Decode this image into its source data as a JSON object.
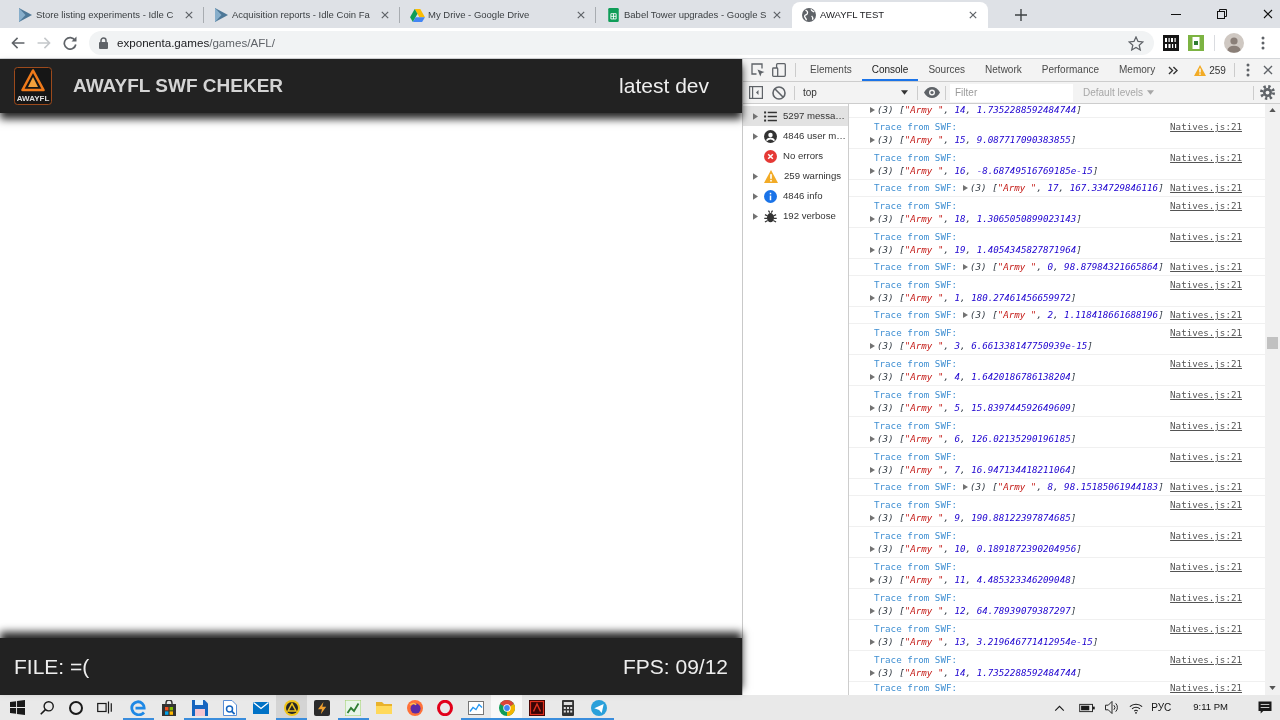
{
  "browser": {
    "tabs": [
      {
        "title": "Store listing experiments - Idle C",
        "selected": false
      },
      {
        "title": "Acquisition reports - Idle Coin Fa",
        "selected": false
      },
      {
        "title": "My Drive - Google Drive",
        "selected": false
      },
      {
        "title": "Babel Tower upgrades - Google S",
        "selected": false
      },
      {
        "title": "AWAYFL TEST",
        "selected": true
      }
    ],
    "navigation": {
      "back_disabled": false,
      "forward_disabled": true
    },
    "address": {
      "host": "exponenta.games",
      "path": "/games/AFL/"
    }
  },
  "page": {
    "logo_text": "AWAYFL",
    "title": "AWAYFL SWF CHEKER",
    "build": "latest dev",
    "file_status": "FILE: =(",
    "fps": "FPS: 09/12"
  },
  "devtools": {
    "tabs": [
      {
        "label": "Elements",
        "selected": false
      },
      {
        "label": "Console",
        "selected": true
      },
      {
        "label": "Sources",
        "selected": false
      },
      {
        "label": "Network",
        "selected": false
      },
      {
        "label": "Performance",
        "selected": false
      },
      {
        "label": "Memory",
        "selected": false
      }
    ],
    "warning_count": "259",
    "console_toolbar": {
      "context": "top",
      "filter": {
        "placeholder": "Filter"
      },
      "levels": {
        "label": "Default levels",
        "disabled": true
      }
    },
    "sidebar": [
      {
        "label": "5297 messa…",
        "selected": true,
        "expandable": true
      },
      {
        "label": "4846 user m…",
        "selected": false,
        "expandable": true
      },
      {
        "label": "No errors",
        "selected": false,
        "expandable": false
      },
      {
        "label": "259 warnings",
        "selected": false,
        "expandable": true
      },
      {
        "label": "4846 info",
        "selected": false,
        "expandable": true
      },
      {
        "label": "192 verbose",
        "selected": false,
        "expandable": true
      }
    ],
    "messages": [
      {
        "kind": "tail",
        "preview": "(3) [\"Army \", 14, 1.7352288592484744]",
        "expanded": false
      },
      {
        "kind": "wrapped",
        "label": "Trace from SWF:",
        "preview": "(3) [\"Army \", 15, 9.087717090383855]",
        "expanded": false,
        "source": "Natives.js:21"
      },
      {
        "kind": "wrapped",
        "label": "Trace from SWF:",
        "preview": "(3) [\"Army \", 16, -8.68749516769185e-15]",
        "expanded": false,
        "source": "Natives.js:21"
      },
      {
        "kind": "inline",
        "label": "Trace from SWF:",
        "preview": "(3) [\"Army \", 17, 167.334729846116]",
        "expanded": false,
        "source": "Natives.js:21"
      },
      {
        "kind": "wrapped",
        "label": "Trace from SWF:",
        "preview": "(3) [\"Army \", 18, 1.3065050899023143]",
        "expanded": false,
        "source": "Natives.js:21"
      },
      {
        "kind": "wrapped",
        "label": "Trace from SWF:",
        "preview": "(3) [\"Army \", 19, 1.4054345827871964]",
        "expanded": false,
        "source": "Natives.js:21"
      },
      {
        "kind": "inline",
        "label": "Trace from SWF:",
        "preview": "(3) [\"Army \", 0, 98.87984321665864]",
        "expanded": false,
        "source": "Natives.js:21"
      },
      {
        "kind": "wrapped",
        "label": "Trace from SWF:",
        "preview": "(3) [\"Army \", 1, 180.27461456659972]",
        "expanded": false,
        "source": "Natives.js:21"
      },
      {
        "kind": "inline",
        "label": "Trace from SWF:",
        "preview": "(3) [\"Army \", 2, 1.118418661688196]",
        "expanded": false,
        "source": "Natives.js:21"
      },
      {
        "kind": "wrapped",
        "label": "Trace from SWF:",
        "preview": "(3) [\"Army \", 3, 6.661338147750939e-15]",
        "expanded": false,
        "source": "Natives.js:21"
      },
      {
        "kind": "wrapped",
        "label": "Trace from SWF:",
        "preview": "(3) [\"Army \", 4, 1.6420186786138204]",
        "expanded": false,
        "source": "Natives.js:21"
      },
      {
        "kind": "wrapped",
        "label": "Trace from SWF:",
        "preview": "(3) [\"Army \", 5, 15.839744592649609]",
        "expanded": false,
        "source": "Natives.js:21"
      },
      {
        "kind": "wrapped",
        "label": "Trace from SWF:",
        "preview": "(3) [\"Army \", 6, 126.02135290196185]",
        "expanded": false,
        "source": "Natives.js:21"
      },
      {
        "kind": "wrapped",
        "label": "Trace from SWF:",
        "preview": "(3) [\"Army \", 7, 16.947134418211064]",
        "expanded": false,
        "source": "Natives.js:21"
      },
      {
        "kind": "inline",
        "label": "Trace from SWF:",
        "preview": "(3) [\"Army \", 8, 98.15185061944183]",
        "expanded": false,
        "source": "Natives.js:21"
      },
      {
        "kind": "wrapped",
        "label": "Trace from SWF:",
        "preview": "(3) [\"Army \", 9, 190.88122397874685]",
        "expanded": false,
        "source": "Natives.js:21"
      },
      {
        "kind": "wrapped",
        "label": "Trace from SWF:",
        "preview": "(3) [\"Army \", 10, 0.1891872390204956]",
        "expanded": false,
        "source": "Natives.js:21"
      },
      {
        "kind": "wrapped",
        "label": "Trace from SWF:",
        "preview": "(3) [\"Army \", 11, 4.485323346209048]",
        "expanded": false,
        "source": "Natives.js:21"
      },
      {
        "kind": "wrapped",
        "label": "Trace from SWF:",
        "preview": "(3) [\"Army \", 12, 64.78939079387297]",
        "expanded": false,
        "source": "Natives.js:21"
      },
      {
        "kind": "wrapped",
        "label": "Trace from SWF:",
        "preview": "(3) [\"Army \", 13, 3.219646771412954e-15]",
        "expanded": false,
        "source": "Natives.js:21"
      },
      {
        "kind": "wrapped",
        "label": "Trace from SWF:",
        "preview": "(3) [\"Army \", 14, 1.7352288592484744]",
        "expanded": false,
        "source": "Natives.js:21"
      },
      {
        "kind": "head",
        "label": "Trace from SWF:",
        "source": "Natives.js:21"
      }
    ]
  },
  "taskbar": {
    "apps": [
      {
        "running": true,
        "active": false,
        "hovered": false
      },
      {
        "running": false,
        "active": false,
        "hovered": false
      },
      {
        "running": true,
        "active": false,
        "hovered": false
      },
      {
        "running": true,
        "active": false,
        "hovered": false
      },
      {
        "running": false,
        "active": false,
        "hovered": false
      },
      {
        "running": true,
        "active": false,
        "hovered": true
      },
      {
        "running": false,
        "active": false,
        "hovered": false
      },
      {
        "running": true,
        "active": false,
        "hovered": false
      },
      {
        "running": false,
        "active": false,
        "hovered": false
      },
      {
        "running": false,
        "active": false,
        "hovered": false
      },
      {
        "running": false,
        "active": false,
        "hovered": false
      },
      {
        "running": true,
        "active": false,
        "hovered": false
      },
      {
        "running": true,
        "active": true,
        "hovered": false
      },
      {
        "running": true,
        "active": false,
        "hovered": false
      },
      {
        "running": true,
        "active": false,
        "hovered": false
      },
      {
        "running": true,
        "active": false,
        "hovered": false
      }
    ],
    "language": "РУС",
    "time": "9:11 PM"
  }
}
